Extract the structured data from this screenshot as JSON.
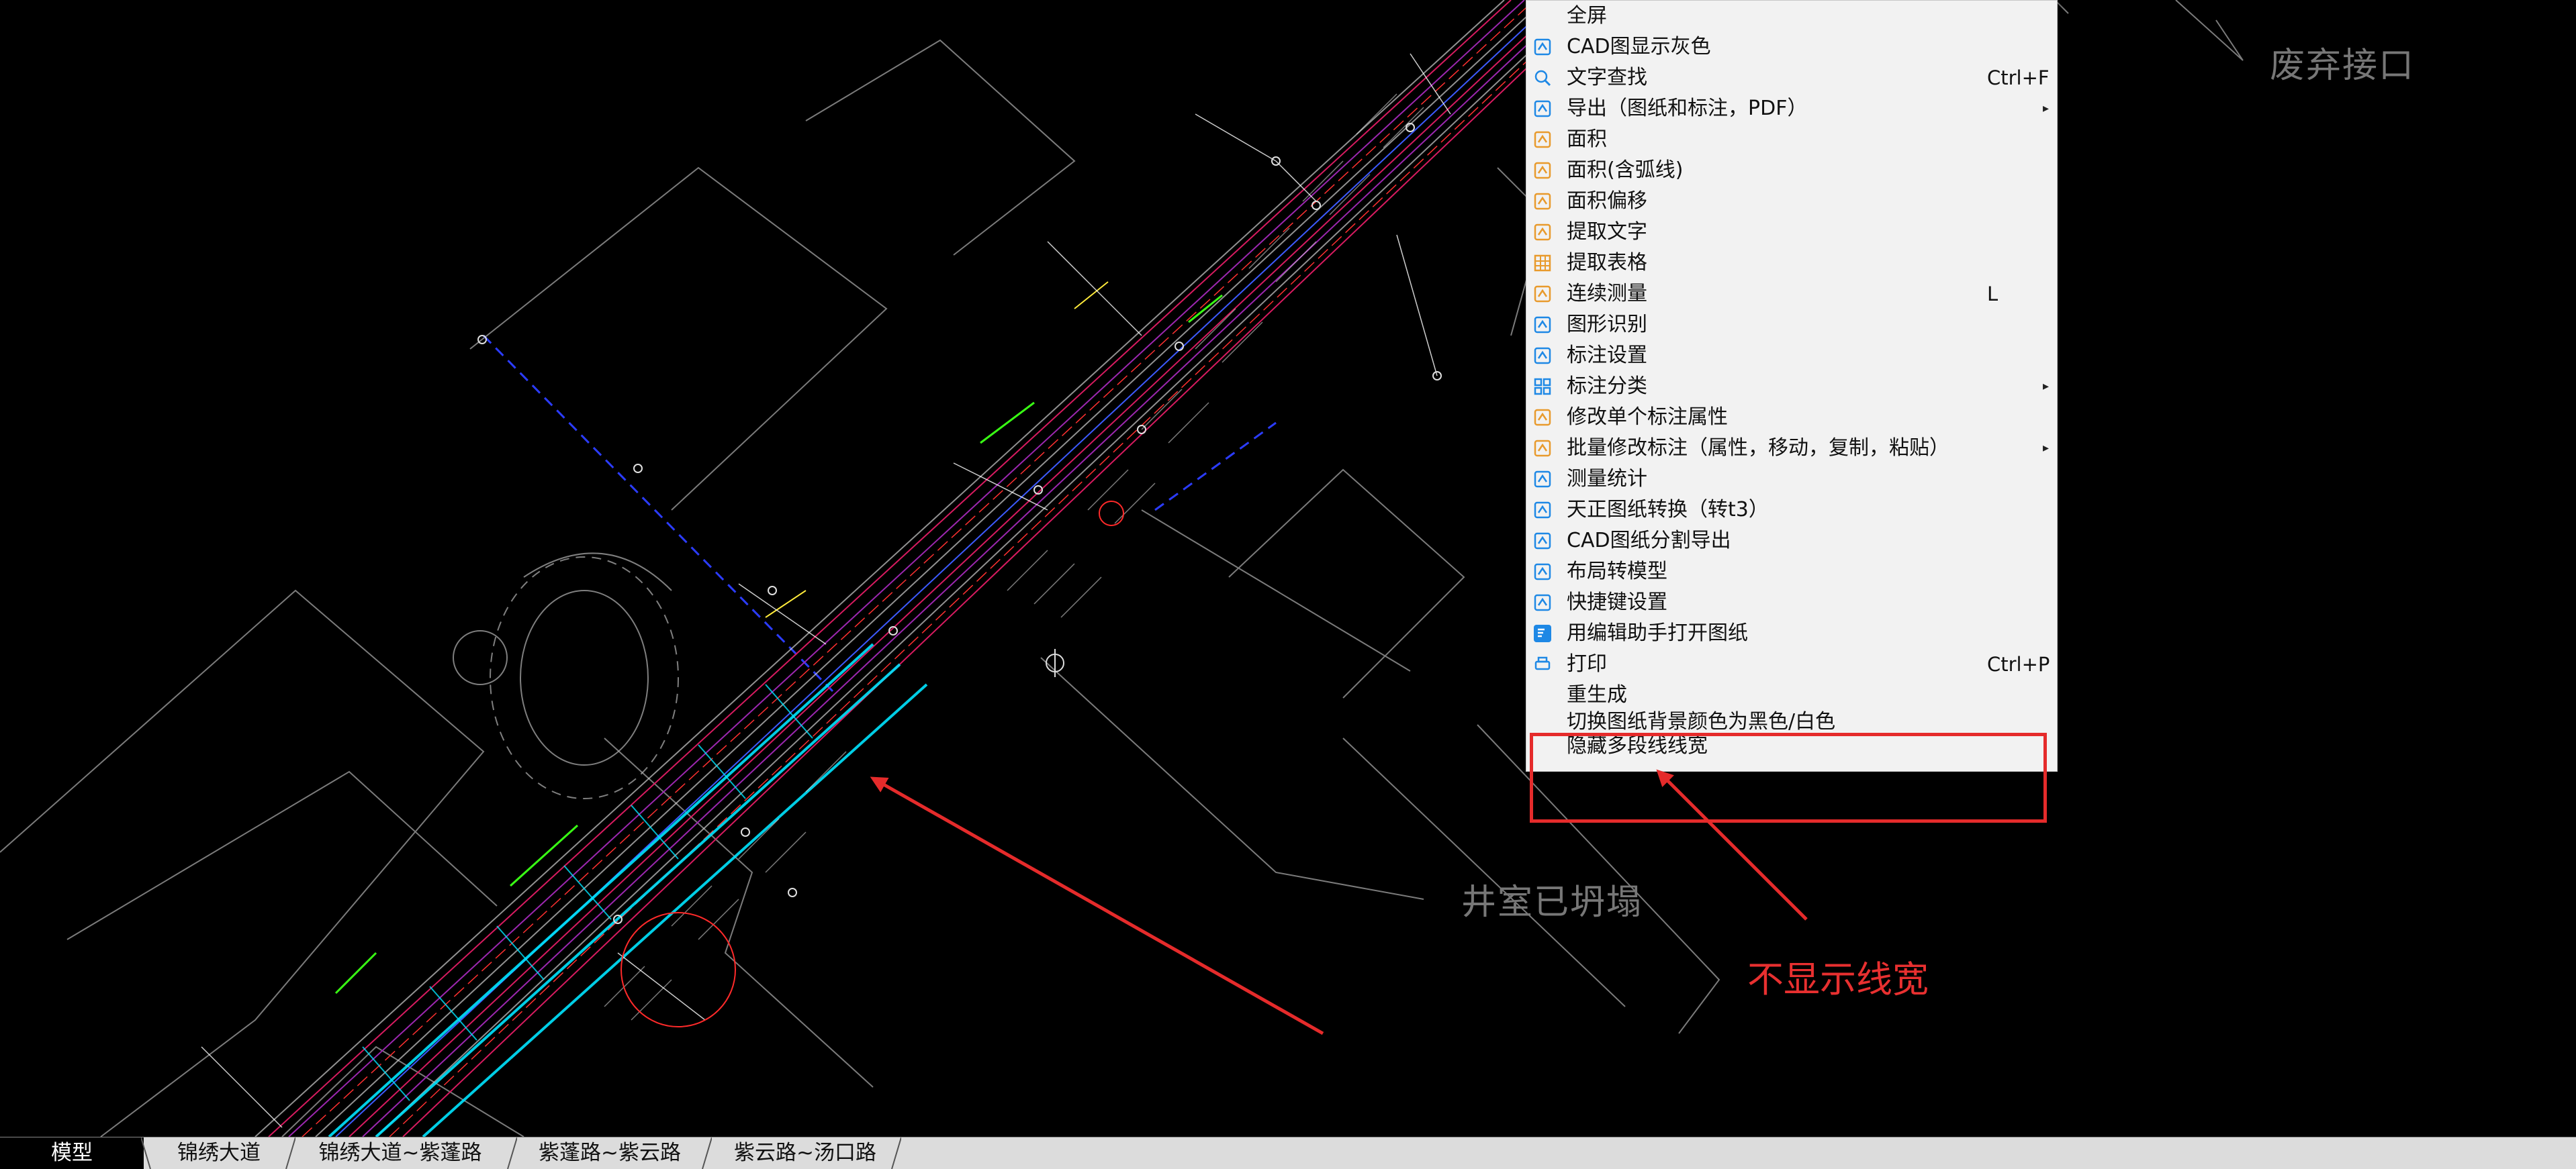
{
  "menu": {
    "items": [
      {
        "label": "全屏",
        "shortcut": "",
        "submenu": false,
        "icon": "none"
      },
      {
        "label": "CAD图显示灰色",
        "shortcut": "",
        "submenu": false,
        "icon": "gray-display-icon"
      },
      {
        "label": "文字查找",
        "shortcut": "Ctrl+F",
        "submenu": false,
        "icon": "text-search-icon"
      },
      {
        "label": "导出（图纸和标注，PDF）",
        "shortcut": "",
        "submenu": true,
        "icon": "export-icon"
      },
      {
        "label": "面积",
        "shortcut": "",
        "submenu": false,
        "icon": "area-icon"
      },
      {
        "label": "面积(含弧线)",
        "shortcut": "",
        "submenu": false,
        "icon": "area-arc-icon"
      },
      {
        "label": "面积偏移",
        "shortcut": "",
        "submenu": false,
        "icon": "area-offset-icon"
      },
      {
        "label": "提取文字",
        "shortcut": "",
        "submenu": false,
        "icon": "extract-text-icon"
      },
      {
        "label": "提取表格",
        "shortcut": "",
        "submenu": false,
        "icon": "extract-table-icon"
      },
      {
        "label": "连续测量",
        "shortcut": "L",
        "submenu": false,
        "icon": "continuous-measure-icon"
      },
      {
        "label": "图形识别",
        "shortcut": "",
        "submenu": false,
        "icon": "shape-recognition-icon"
      },
      {
        "label": "标注设置",
        "shortcut": "",
        "submenu": false,
        "icon": "annotation-settings-icon"
      },
      {
        "label": "标注分类",
        "shortcut": "",
        "submenu": true,
        "icon": "annotation-category-icon"
      },
      {
        "label": "修改单个标注属性",
        "shortcut": "",
        "submenu": false,
        "icon": "edit-annotation-icon"
      },
      {
        "label": "批量修改标注（属性，移动，复制，粘贴）",
        "shortcut": "",
        "submenu": true,
        "icon": "batch-edit-icon"
      },
      {
        "label": "测量统计",
        "shortcut": "",
        "submenu": false,
        "icon": "measure-stats-icon"
      },
      {
        "label": "天正图纸转换（转t3）",
        "shortcut": "",
        "submenu": false,
        "icon": "tangent-convert-icon"
      },
      {
        "label": "CAD图纸分割导出",
        "shortcut": "",
        "submenu": false,
        "icon": "split-export-icon"
      },
      {
        "label": "布局转模型",
        "shortcut": "",
        "submenu": false,
        "icon": "layout-to-model-icon"
      },
      {
        "label": "快捷键设置",
        "shortcut": "",
        "submenu": false,
        "icon": "shortcut-settings-icon"
      },
      {
        "label": "用编辑助手打开图纸",
        "shortcut": "",
        "submenu": false,
        "icon": "edit-assistant-icon"
      },
      {
        "label": "打印",
        "shortcut": "Ctrl+P",
        "submenu": false,
        "icon": "print-icon"
      },
      {
        "label": "重生成",
        "shortcut": "",
        "submenu": false,
        "icon": "none"
      },
      {
        "label": "切换图纸背景颜色为黑色/白色",
        "shortcut": "",
        "submenu": false,
        "icon": "none"
      },
      {
        "label": "隐藏多段线线宽",
        "shortcut": "",
        "submenu": false,
        "icon": "none"
      }
    ]
  },
  "annotation": {
    "text": "不显示线宽",
    "color": "#e83030"
  },
  "cad_notes": {
    "abandoned": "废弃接口",
    "collapsed": "井室已坍塌"
  },
  "tabs": [
    {
      "label": "模型",
      "active": true
    },
    {
      "label": "锦绣大道",
      "active": false
    },
    {
      "label": "锦绣大道~紫蓬路",
      "active": false
    },
    {
      "label": "紫蓬路~紫云路",
      "active": false
    },
    {
      "label": "紫云路~汤口路",
      "active": false
    }
  ],
  "colors": {
    "canvas_bg": "#000000",
    "menu_bg": "#f2f2f2",
    "highlight": "#e52b2b",
    "icon_accent": "#1e88e5",
    "icon_orange": "#e89a2c"
  }
}
